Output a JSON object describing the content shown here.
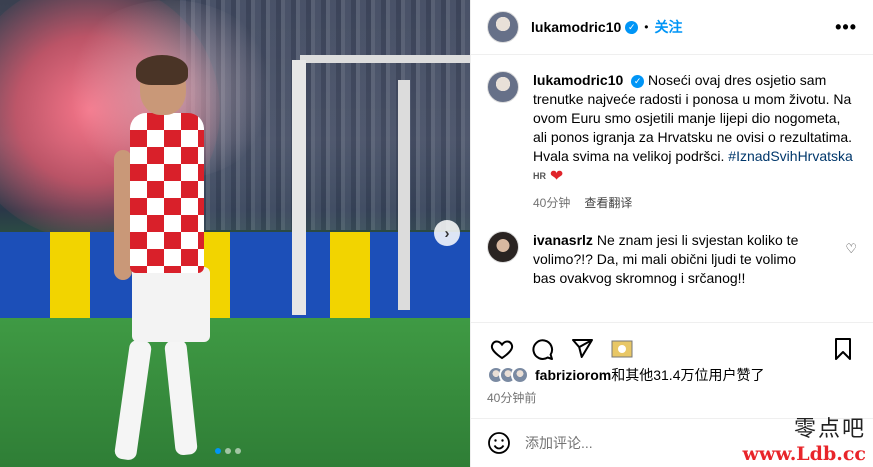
{
  "post": {
    "username": "lukamodric10",
    "separator": "•",
    "follow_label": "关注",
    "more_label": "•••",
    "caption": "Noseći ovaj dres osjetio sam trenutke najveće radosti i ponosa u mom životu. Na ovom Euru smo osjetili manje lijepi dio nogometa, ali ponos igranja za Hrvatsku ne ovisi o rezultatima. Hvala svima na velikoj podršci.",
    "hashtag": "#IznadSvihHrvatska",
    "flag_label": "HR",
    "caption_time": "40分钟",
    "translate_label": "查看翻译"
  },
  "comment": {
    "username": "ivanasrlz",
    "text": "Ne znam jesi li svjestan koliko te volimo?!? Da, mi mali obični ljudi te volimo bas ovakvog skromnog i srčanog!!"
  },
  "likes": {
    "user": "fabriziorom",
    "rest": "和其他31.4万位用户赞了",
    "time": "40分钟前"
  },
  "add_comment": {
    "placeholder": "添加评论..."
  },
  "watermark": {
    "line1": "零点吧",
    "line2": "www.Ldb.cc"
  },
  "carousel": {
    "next_icon": "chevron-right-icon",
    "dots": 3,
    "active": 1
  },
  "colors": {
    "accent": "#0095f6",
    "heart": "#e0242b",
    "hashtag": "#00376b"
  }
}
